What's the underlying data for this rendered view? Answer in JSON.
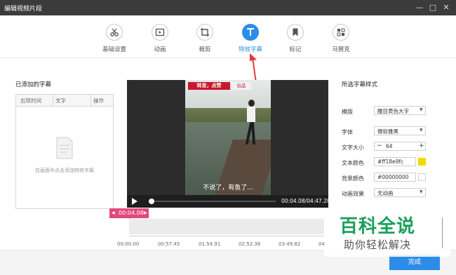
{
  "window": {
    "title": "编辑视频片段"
  },
  "toolbar": {
    "tools": [
      {
        "label": "基础设置",
        "icon": "scissors-icon"
      },
      {
        "label": "动画",
        "icon": "animation-icon"
      },
      {
        "label": "裁剪",
        "icon": "crop-icon"
      },
      {
        "label": "特效字幕",
        "icon": "text-icon",
        "active": true
      },
      {
        "label": "标记",
        "icon": "bookmark-icon"
      },
      {
        "label": "马赛克",
        "icon": "mosaic-icon"
      }
    ]
  },
  "left_panel": {
    "title": "已添加的字幕",
    "columns": [
      "出现时间",
      "文字",
      "操作"
    ],
    "empty_text": "在画面中点击添加特效字幕"
  },
  "preview": {
    "banner_text": "转发，点赞",
    "banner_sub": "出品",
    "subtitle_text": "不说了，有鱼了...",
    "time_display": "00:04.08/04:47.28",
    "progress": 0.014
  },
  "right_panel": {
    "title": "所选字幕样式",
    "template_label": "模版",
    "template_value": "醒目黄色大字",
    "font_label": "字体",
    "font_value": "微软雅黑",
    "size_label": "文字大小",
    "size_value": "64",
    "text_color_label": "文本颜色",
    "text_color_value": "#ff18e9fc",
    "bg_color_label": "背景颜色",
    "bg_color_value": "#00000000",
    "effect_label": "动画效果",
    "effect_value": "无动画",
    "swatch_color": "#f5d800"
  },
  "timeline": {
    "marker_time": "00:04.08",
    "ticks": [
      "00:00.00",
      "00:57.45",
      "01:54.91",
      "02:52.36",
      "03:49.82",
      "04:"
    ]
  },
  "footer": {
    "done_label": "完成"
  },
  "watermark": {
    "title": "百科全说",
    "subtitle": "助你轻松解决"
  },
  "colors": {
    "accent": "#2c8de8",
    "marker": "#e2487d",
    "annotation_arrow": "#e53935"
  }
}
